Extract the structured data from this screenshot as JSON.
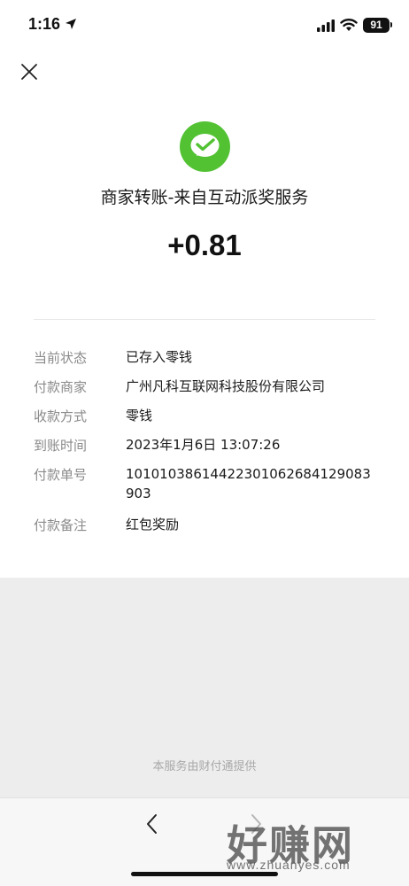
{
  "status_bar": {
    "time": "1:16",
    "battery": "91"
  },
  "detail": {
    "title": "商家转账-来自互动派奖服务",
    "amount": "+0.81",
    "rows": [
      {
        "label": "当前状态",
        "value": "已存入零钱"
      },
      {
        "label": "付款商家",
        "value": "广州凡科互联网科技股份有限公司"
      },
      {
        "label": "收款方式",
        "value": "零钱"
      },
      {
        "label": "到账时间",
        "value": "2023年1月6日 13:07:26"
      },
      {
        "label": "付款单号",
        "value": "10101038614422301062684129083903"
      },
      {
        "label": "付款备注",
        "value": "红包奖励"
      }
    ]
  },
  "footer": {
    "note": "本服务由财付通提供"
  },
  "watermark": {
    "text": "好赚网",
    "url": "www.zhuanyes.com"
  },
  "colors": {
    "wechat_green": "#52c233",
    "background": "#ededed",
    "card": "#ffffff"
  },
  "icons": [
    "location-arrow-icon",
    "signal-icon",
    "wifi-icon",
    "battery-icon",
    "close-icon",
    "wechat-pay-icon",
    "back-arrow-icon",
    "forward-arrow-icon"
  ]
}
